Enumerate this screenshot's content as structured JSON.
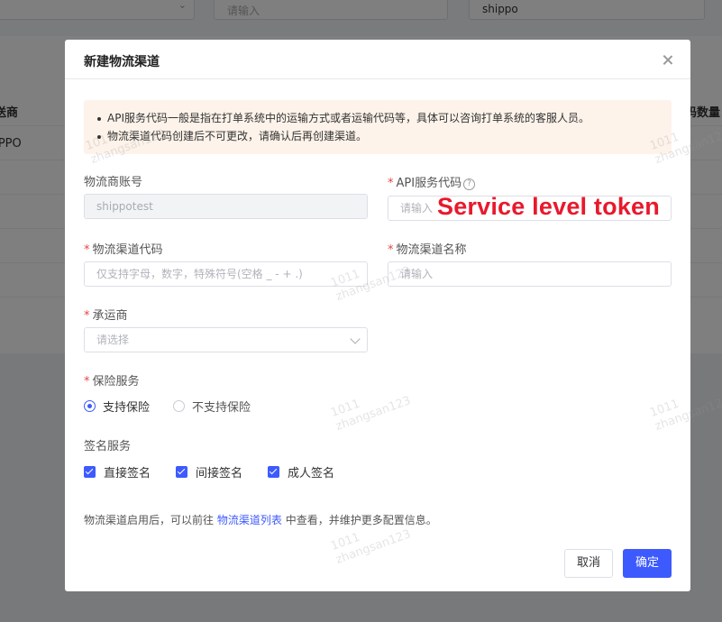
{
  "background": {
    "search_placeholder": "请输入",
    "filter_value": "shippo",
    "table_header_left": "送商",
    "table_header_right": "码数量",
    "row_value": "IPPO"
  },
  "modal": {
    "title": "新建物流渠道",
    "notice": [
      "API服务代码一般是指在打单系统中的运输方式或者运输代码等，具体可以咨询打单系统的客服人员。",
      "物流渠道代码创建后不可更改，请确认后再创建渠道。"
    ],
    "fields": {
      "account": {
        "label": "物流商账号",
        "value": "shippotest"
      },
      "api_code": {
        "label": "API服务代码",
        "placeholder": "请输入",
        "required": true
      },
      "channel_code": {
        "label": "物流渠道代码",
        "placeholder": "仅支持字母，数字，特殊符号(空格 _ - + .)",
        "required": true
      },
      "channel_name": {
        "label": "物流渠道名称",
        "placeholder": "请输入",
        "required": true
      },
      "carrier": {
        "label": "承运商",
        "placeholder": "请选择",
        "required": true
      },
      "insurance": {
        "label": "保险服务",
        "required": true,
        "options": [
          "支持保险",
          "不支持保险"
        ],
        "selected": "支持保险"
      },
      "signature": {
        "label": "签名服务",
        "options": [
          "直接签名",
          "间接签名",
          "成人签名"
        ],
        "checked": [
          "直接签名",
          "间接签名",
          "成人签名"
        ]
      }
    },
    "footer_note": {
      "before": "物流渠道启用后，可以前往",
      "link": "物流渠道列表",
      "after": "中查看，并维护更多配置信息。"
    },
    "buttons": {
      "cancel": "取消",
      "ok": "确定"
    },
    "annotation": "Service level token",
    "required_mark": "*"
  },
  "watermark": {
    "line1": "1011",
    "line2": "zhangsan123"
  },
  "colors": {
    "primary": "#3d5afe",
    "required": "#e64545",
    "annotation": "#e8192c",
    "notice_bg": "#fdf3ea"
  }
}
